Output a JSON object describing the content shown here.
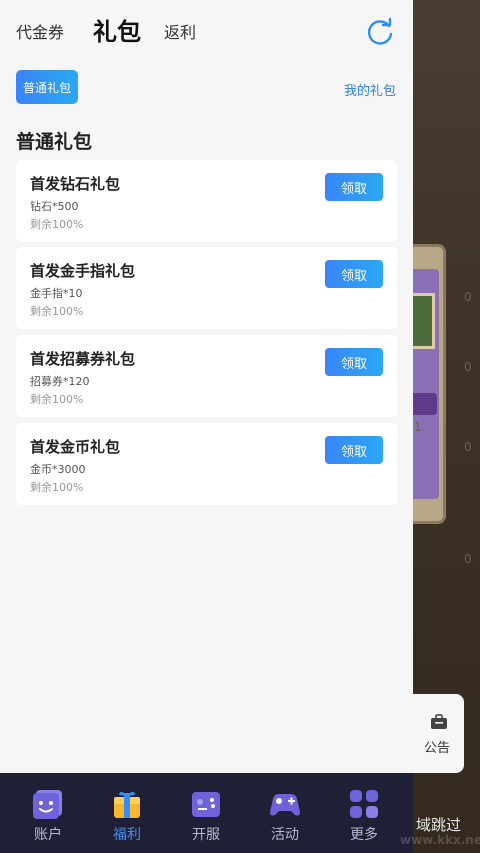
{
  "tabs": [
    {
      "label": "代金券"
    },
    {
      "label": "礼包"
    },
    {
      "label": "返利"
    }
  ],
  "filter": {
    "active_chip": "普通礼包",
    "my_gifts": "我的礼包"
  },
  "section_title": "普通礼包",
  "gifts": [
    {
      "name": "首发钻石礼包",
      "detail": "钻石*500",
      "remain": "剩余100%",
      "button": "领取"
    },
    {
      "name": "首发金手指礼包",
      "detail": "金手指*10",
      "remain": "剩余100%",
      "button": "领取"
    },
    {
      "name": "首发招募券礼包",
      "detail": "招募券*120",
      "remain": "剩余100%",
      "button": "领取"
    },
    {
      "name": "首发金币礼包",
      "detail": "金币*3000",
      "remain": "剩余100%",
      "button": "领取"
    }
  ],
  "notice": {
    "label": "公告",
    "icon": "briefcase-icon"
  },
  "nav": [
    {
      "label": "账户",
      "icon": "account-face-icon"
    },
    {
      "label": "福利",
      "icon": "gift-icon"
    },
    {
      "label": "开服",
      "icon": "server-gamepad-icon"
    },
    {
      "label": "活动",
      "icon": "gamepad-icon"
    },
    {
      "label": "更多",
      "icon": "grid-more-icon"
    }
  ],
  "skip_label": "域跳过",
  "watermark": "www.kkx.net",
  "game_numbers": [
    "1",
    "0",
    "0",
    "0",
    "0"
  ],
  "colors": {
    "accent": "#3a85f6",
    "nav_bg": "#1f2036",
    "nav_active": "#4a8cf5"
  }
}
